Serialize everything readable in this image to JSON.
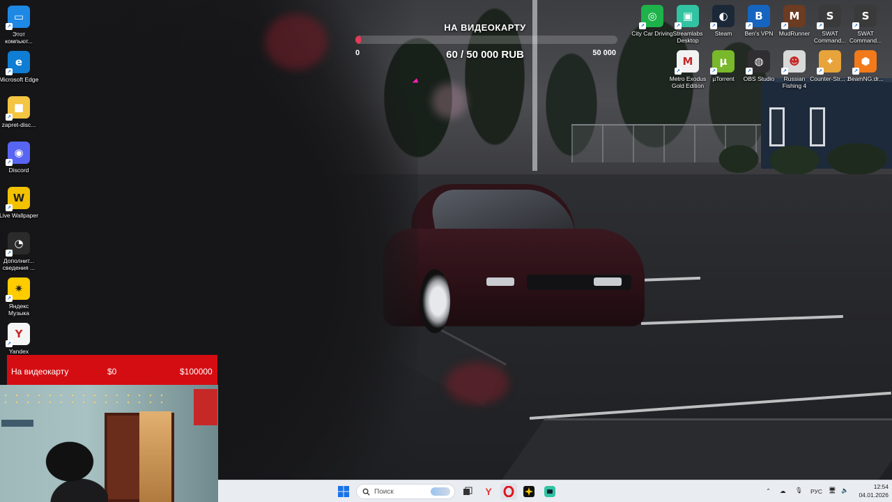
{
  "desktop_icons_left": [
    {
      "label": "Этот компьют...",
      "icon": "monitor-icon",
      "color": "#1e88e5"
    },
    {
      "label": "Microsoft Edge",
      "icon": "edge-icon",
      "color": "#0f7dd3"
    },
    {
      "label": "zapret-disc...",
      "icon": "folder-icon",
      "color": "#f4c542"
    },
    {
      "label": "Discord",
      "icon": "discord-icon",
      "color": "#5865f2"
    },
    {
      "label": "Live Wallpaper",
      "icon": "live-wallpaper-icon",
      "color": "#f2c200"
    },
    {
      "label": "Дополнит... сведения ...",
      "icon": "info-icon",
      "color": "#2b2b2b"
    },
    {
      "label": "Яндекс Музыка",
      "icon": "yandex-music-icon",
      "color": "#ffcc00"
    },
    {
      "label": "Yandex",
      "icon": "yandex-browser-icon",
      "color": "#f5f5f5"
    }
  ],
  "desktop_icons_right_row1": [
    {
      "label": "City Car Driving",
      "icon": "city-car-driving-icon",
      "color": "#1db34a"
    },
    {
      "label": "Streamlabs Desktop",
      "icon": "streamlabs-icon",
      "color": "#31c3a2"
    },
    {
      "label": "Steam",
      "icon": "steam-icon",
      "color": "#1b2838"
    },
    {
      "label": "Ben's VPN",
      "icon": "vpn-icon",
      "color": "#1565c0"
    },
    {
      "label": "MudRunner",
      "icon": "mudrunner-icon",
      "color": "#6b3b22"
    },
    {
      "label": "SWAT Command...",
      "icon": "swat-icon",
      "color": "#3a3a3a"
    },
    {
      "label": "SWAT Command...",
      "icon": "swat-icon",
      "color": "#3a3a3a"
    }
  ],
  "desktop_icons_right_row2": [
    {
      "label": "Metro Exodus Gold Edition",
      "icon": "metro-exodus-icon",
      "color": "#f2f2f2"
    },
    {
      "label": "µTorrent",
      "icon": "utorrent-icon",
      "color": "#78b82a"
    },
    {
      "label": "OBS Studio",
      "icon": "obs-icon",
      "color": "#302e31"
    },
    {
      "label": "Russian Fishing 4",
      "icon": "russian-fishing-icon",
      "color": "#d9d9d9"
    },
    {
      "label": "Counter-Str... 2",
      "icon": "counter-strike-icon",
      "color": "#e8a33b"
    },
    {
      "label": "BeamNG.dr...",
      "icon": "beamng-icon",
      "color": "#f27a1a"
    }
  ],
  "donation_goal": {
    "title": "НА ВИДЕОКАРТУ",
    "min_label": "0",
    "max_label": "50 000",
    "value_text": "60 / 50 000 RUB",
    "raised": 60,
    "target": 50000,
    "bar_color": "#e63a5a"
  },
  "red_goal_widget": {
    "title": "На видеокарту",
    "current": "$0",
    "target": "$100000",
    "color": "#d40d12"
  },
  "taskbar": {
    "search_placeholder": "Поиск",
    "apps": [
      {
        "icon": "windows-start-icon",
        "color": "#1a73e8"
      },
      {
        "icon": "task-view-icon",
        "color": "#333333"
      },
      {
        "icon": "yandex-browser-icon",
        "color": "#e53935"
      },
      {
        "icon": "opera-icon",
        "color": "#e0141e"
      },
      {
        "icon": "yandex-music-icon",
        "color": "#ffcc00"
      },
      {
        "icon": "streamlabs-icon",
        "color": "#31c3a2"
      }
    ],
    "tray": {
      "language": "РУС",
      "time": "12:54",
      "date": "04.01.2026"
    }
  }
}
